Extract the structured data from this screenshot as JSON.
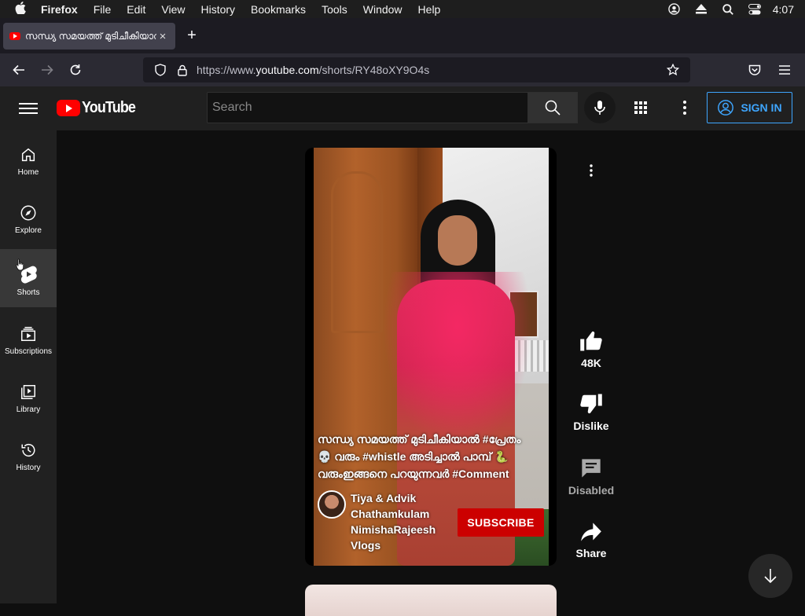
{
  "menubar": {
    "app": "Firefox",
    "items": [
      "File",
      "Edit",
      "View",
      "History",
      "Bookmarks",
      "Tools",
      "Window",
      "Help"
    ],
    "clock": "4:07"
  },
  "browser": {
    "tab_title": "സന്ധ്യ സമയത്ത് മുടിചീകിയാൽ #ശ",
    "url_prefix": "https://www.",
    "url_domain": "youtube.com",
    "url_path": "/shorts/RY48oXY9O4s"
  },
  "youtube": {
    "logo_text": "YouTube",
    "search_placeholder": "Search",
    "sign_in": "SIGN IN",
    "sidebar": [
      {
        "label": "Home",
        "icon": "home-icon"
      },
      {
        "label": "Explore",
        "icon": "compass-icon"
      },
      {
        "label": "Shorts",
        "icon": "shorts-icon"
      },
      {
        "label": "Subscriptions",
        "icon": "subscriptions-icon"
      },
      {
        "label": "Library",
        "icon": "library-icon"
      },
      {
        "label": "History",
        "icon": "history-icon"
      }
    ],
    "short": {
      "caption_line1": "സന്ധ്യ സമയത്ത് മുടിചീകിയാൽ #പ്രേതം",
      "caption_line2": "💀 വരും #whistle അടിച്ചാൽ പാമ്പ് 🐍",
      "caption_line3": "വരുംഇങ്ങനെ പറയുന്നവർ #Comment",
      "channel_name": "Tiya & Advik Chathamkulam NimishaRajeesh Vlogs",
      "subscribe": "SUBSCRIBE"
    },
    "actions": {
      "like_count": "48K",
      "dislike": "Dislike",
      "comments": "Disabled",
      "share": "Share"
    }
  },
  "colors": {
    "accent_blue": "#3ea6ff",
    "youtube_red": "#ff0000",
    "subscribe_red": "#cc0000"
  }
}
